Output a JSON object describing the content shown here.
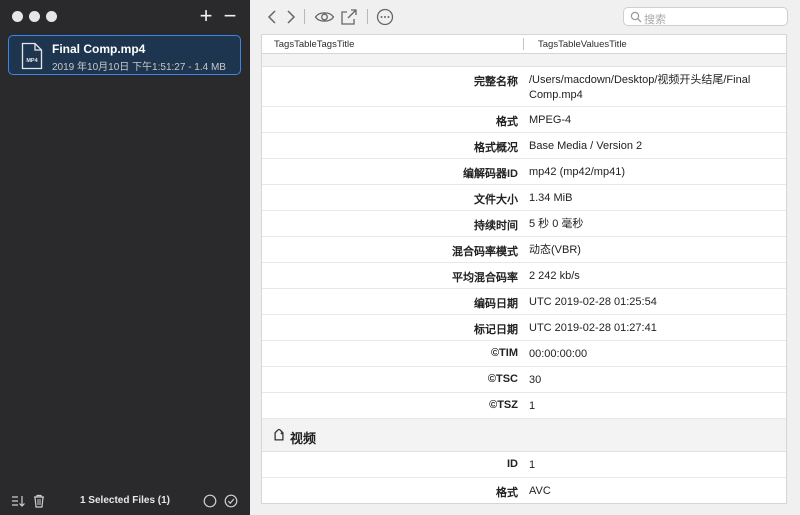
{
  "sidebar": {
    "add_label": "+",
    "remove_label": "−",
    "file": {
      "name": "Final Comp.mp4",
      "meta": "2019 年10月10日 下午1:51:27 - 1.4 MB",
      "badge": "MP4"
    },
    "selected_count": "1 Selected Files (1)"
  },
  "search": {
    "placeholder": "搜索"
  },
  "table": {
    "col_tags": "TagsTableTagsTitle",
    "col_values": "TagsTableValuesTitle",
    "general_rows": [
      {
        "key": "完整名称",
        "value": "/Users/macdown/Desktop/视频开头结尾/Final Comp.mp4"
      },
      {
        "key": "格式",
        "value": "MPEG-4"
      },
      {
        "key": "格式概况",
        "value": "Base Media / Version 2"
      },
      {
        "key": "编解码器ID",
        "value": "mp42 (mp42/mp41)"
      },
      {
        "key": "文件大小",
        "value": "1.34 MiB"
      },
      {
        "key": "持续时间",
        "value": "5 秒 0 毫秒"
      },
      {
        "key": "混合码率模式",
        "value": "动态(VBR)"
      },
      {
        "key": "平均混合码率",
        "value": "2 242 kb/s"
      },
      {
        "key": "编码日期",
        "value": "UTC 2019-02-28 01:25:54"
      },
      {
        "key": "标记日期",
        "value": "UTC 2019-02-28 01:27:41"
      },
      {
        "key": "©TIM",
        "value": "00:00:00:00"
      },
      {
        "key": "©TSC",
        "value": "30"
      },
      {
        "key": "©TSZ",
        "value": "1"
      }
    ],
    "video_section_title": "视频",
    "video_rows": [
      {
        "key": "ID",
        "value": "1"
      },
      {
        "key": "格式",
        "value": "AVC"
      }
    ]
  },
  "colors": {
    "accent": "#3d86e6",
    "sidebar_bg": "#2a2a2c"
  }
}
